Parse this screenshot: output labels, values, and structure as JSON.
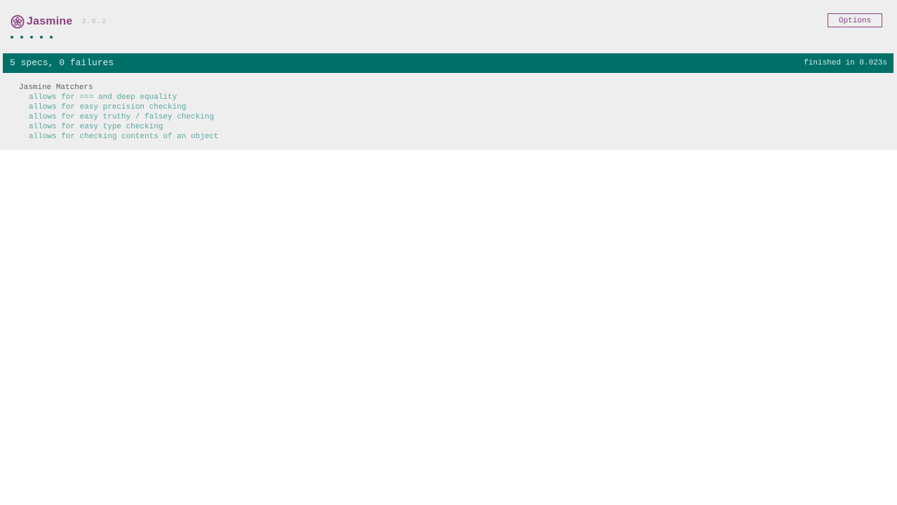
{
  "header": {
    "logo_text": "Jasmine",
    "version": "2.6.2",
    "options_label": "Options"
  },
  "symbols": {
    "passed_count": 5,
    "status": "passed",
    "color": "#007069"
  },
  "status_bar": {
    "summary": "5 specs, 0 failures",
    "duration": "finished in 0.023s",
    "color": "#007069"
  },
  "suite": {
    "name": "Jasmine Matchers",
    "specs": [
      {
        "label": "allows for === and deep equality"
      },
      {
        "label": "allows for easy precision checking"
      },
      {
        "label": "allows for easy truthy / falsey checking"
      },
      {
        "label": "allows for easy type checking"
      },
      {
        "label": "allows for checking contents of an object"
      }
    ]
  },
  "colors": {
    "brand": "#8a4182",
    "passed": "#007069",
    "spec_link": "#5ba89f",
    "background": "#eeeeee"
  }
}
